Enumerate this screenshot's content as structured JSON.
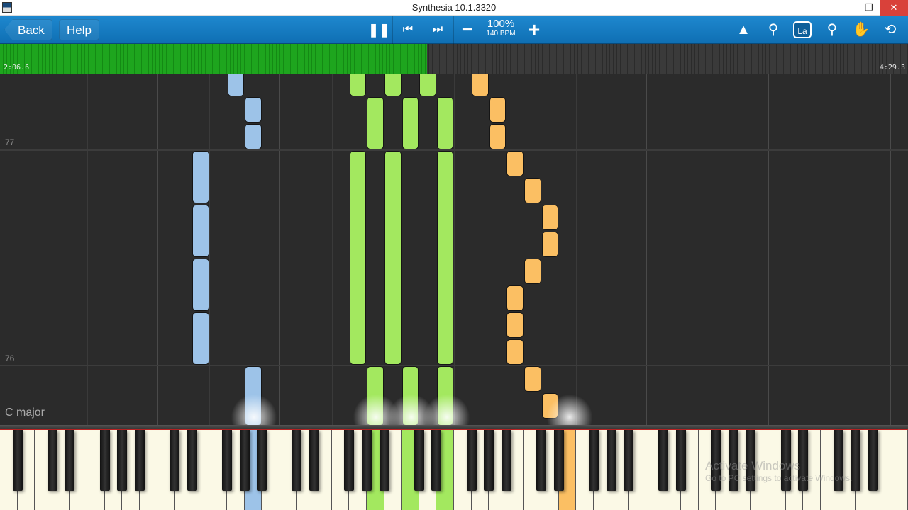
{
  "window": {
    "title": "Synthesia 10.1.3320",
    "minimize": "–",
    "restore": "❐",
    "close": "✕"
  },
  "toolbar": {
    "back_label": "Back",
    "help_label": "Help",
    "speed_percent": "100%",
    "tempo": "140 BPM",
    "icons": {
      "pause": "❚❚",
      "previous": "⏮",
      "next": "⏭",
      "slower": "−",
      "faster": "+",
      "metronome": "▲",
      "zoom": "⚲",
      "label": "La",
      "bookmark": "⚲",
      "hand": "✋",
      "loop": "⟲"
    }
  },
  "progress": {
    "current_time": "2:06.6",
    "total_time": "4:29.3",
    "fraction": 0.47
  },
  "playfield": {
    "measures": [
      "77",
      "76"
    ],
    "key_signature": "C major"
  },
  "colors": {
    "blue": "#9dc3e8",
    "green": "#a3e85f",
    "orange": "#fbbf63",
    "progress": "#1ea51e"
  },
  "notes": [
    {
      "key": 13,
      "start": 12.25,
      "len": 1,
      "color": "blue"
    },
    {
      "key": 14,
      "start": 11.25,
      "len": 0.9,
      "color": "blue"
    },
    {
      "key": 14,
      "start": 10.25,
      "len": 0.9,
      "color": "blue"
    },
    {
      "key": 11,
      "start": 8.25,
      "len": 1.9,
      "color": "blue"
    },
    {
      "key": 11,
      "start": 6.25,
      "len": 1.9,
      "color": "blue"
    },
    {
      "key": 11,
      "start": 4.25,
      "len": 1.9,
      "color": "blue"
    },
    {
      "key": 11,
      "start": 2.25,
      "len": 1.9,
      "color": "blue"
    },
    {
      "key": 14,
      "start": 0,
      "len": 2.15,
      "color": "blue"
    },
    {
      "key": 20,
      "start": 12.25,
      "len": 1,
      "color": "green"
    },
    {
      "key": 22,
      "start": 12.25,
      "len": 1,
      "color": "green"
    },
    {
      "key": 24,
      "start": 12.25,
      "len": 1,
      "color": "green"
    },
    {
      "key": 21,
      "start": 10.25,
      "len": 1.9,
      "color": "green"
    },
    {
      "key": 23,
      "start": 10.25,
      "len": 1.9,
      "color": "green"
    },
    {
      "key": 25,
      "start": 10.25,
      "len": 1.9,
      "color": "green"
    },
    {
      "key": 20,
      "start": 2.25,
      "len": 7.9,
      "color": "green"
    },
    {
      "key": 22,
      "start": 2.25,
      "len": 7.9,
      "color": "green"
    },
    {
      "key": 25,
      "start": 2.25,
      "len": 7.9,
      "color": "green"
    },
    {
      "key": 21,
      "start": 0,
      "len": 2.15,
      "color": "green"
    },
    {
      "key": 23,
      "start": 0,
      "len": 2.15,
      "color": "green"
    },
    {
      "key": 25,
      "start": 0,
      "len": 2.15,
      "color": "green"
    },
    {
      "key": 27,
      "start": 12.25,
      "len": 1,
      "color": "orange"
    },
    {
      "key": 28,
      "start": 11.25,
      "len": 0.9,
      "color": "orange"
    },
    {
      "key": 28,
      "start": 10.25,
      "len": 0.9,
      "color": "orange"
    },
    {
      "key": 29,
      "start": 9.25,
      "len": 0.9,
      "color": "orange"
    },
    {
      "key": 30,
      "start": 8.25,
      "len": 0.9,
      "color": "orange"
    },
    {
      "key": 31,
      "start": 7.25,
      "len": 0.9,
      "color": "orange"
    },
    {
      "key": 31,
      "start": 6.25,
      "len": 0.9,
      "color": "orange"
    },
    {
      "key": 30,
      "start": 5.25,
      "len": 0.9,
      "color": "orange"
    },
    {
      "key": 29,
      "start": 4.25,
      "len": 0.9,
      "color": "orange"
    },
    {
      "key": 29,
      "start": 3.25,
      "len": 0.9,
      "color": "orange"
    },
    {
      "key": 29,
      "start": 2.25,
      "len": 0.9,
      "color": "orange"
    },
    {
      "key": 30,
      "start": 1.25,
      "len": 0.9,
      "color": "orange"
    },
    {
      "key": 31,
      "start": 0.25,
      "len": 0.9,
      "color": "orange"
    }
  ],
  "pressed_keys": [
    {
      "key": 14,
      "color": "blue"
    },
    {
      "key": 21,
      "color": "green"
    },
    {
      "key": 23,
      "color": "green"
    },
    {
      "key": 25,
      "color": "green"
    },
    {
      "key": 32,
      "color": "orange"
    }
  ],
  "watermark": {
    "line1": "Activate Windows",
    "line2": "Go to PC settings to activate Windows."
  }
}
